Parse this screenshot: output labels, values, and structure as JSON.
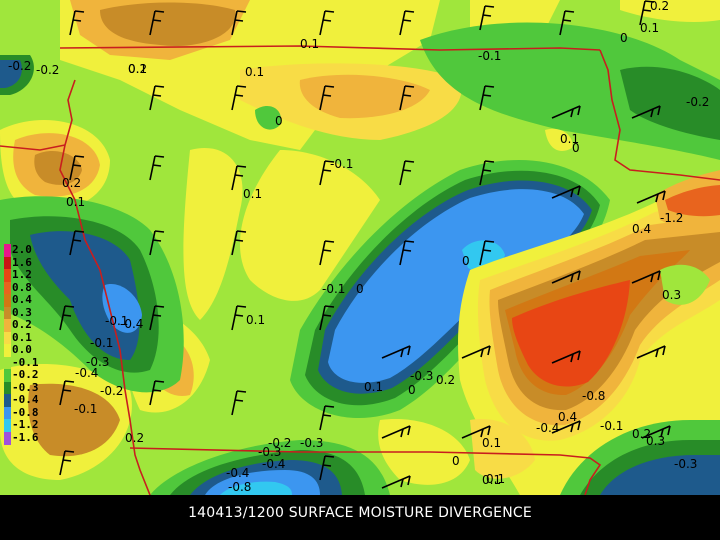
{
  "caption": "140413/1200 SURFACE MOISTURE DIVERGENCE",
  "legend": {
    "levels": [
      "2.0",
      "1.6",
      "1.2",
      "0.8",
      "0.4",
      "0.3",
      "0.2",
      "0.1",
      "0.0",
      "-0.1",
      "-0.2",
      "-0.3",
      "-0.4",
      "-0.8",
      "-1.2",
      "-1.6"
    ],
    "colors": [
      "#e8178c",
      "#c81414",
      "#e84614",
      "#e8641e",
      "#d27814",
      "#c88c28",
      "#f0b43c",
      "#f8dc46",
      "#f0f03c",
      "#a0e63c",
      "#50c83c",
      "#288c28",
      "#1e5a8c",
      "#3c96f0",
      "#32c8f0",
      "#a050dc"
    ]
  },
  "contour_labels": [
    "0.2",
    "0.1",
    "0.1",
    "-0.1",
    "-0.2",
    "0",
    "0.1",
    "0",
    "-0.1",
    "0.2",
    "0.1",
    "0.1",
    "-0.2",
    "0",
    "-0.1",
    "0",
    "0.1",
    "0",
    "0.1",
    "-0.8",
    "-0.4",
    "0.4",
    "0.3",
    "-0.1",
    "-0.1",
    "-0.3",
    "-0.4",
    "-0.2",
    "-0.1",
    "0.2",
    "0.1",
    "0",
    "0.1",
    "-0.3",
    "-0.4",
    "-0.3",
    "0.2",
    "-0.2",
    "-0.4",
    "-0.8",
    "-1.2",
    "0.2",
    "0.3",
    "0.4",
    "-0.1",
    "-0.3",
    "-0.2",
    "-0.4",
    "0.1",
    "0",
    "0.1",
    "-0.3",
    "0.2",
    "0.1"
  ],
  "colors": {
    "background": "#000000",
    "state_border": "#c81e1e",
    "caption": "#ffffff"
  }
}
